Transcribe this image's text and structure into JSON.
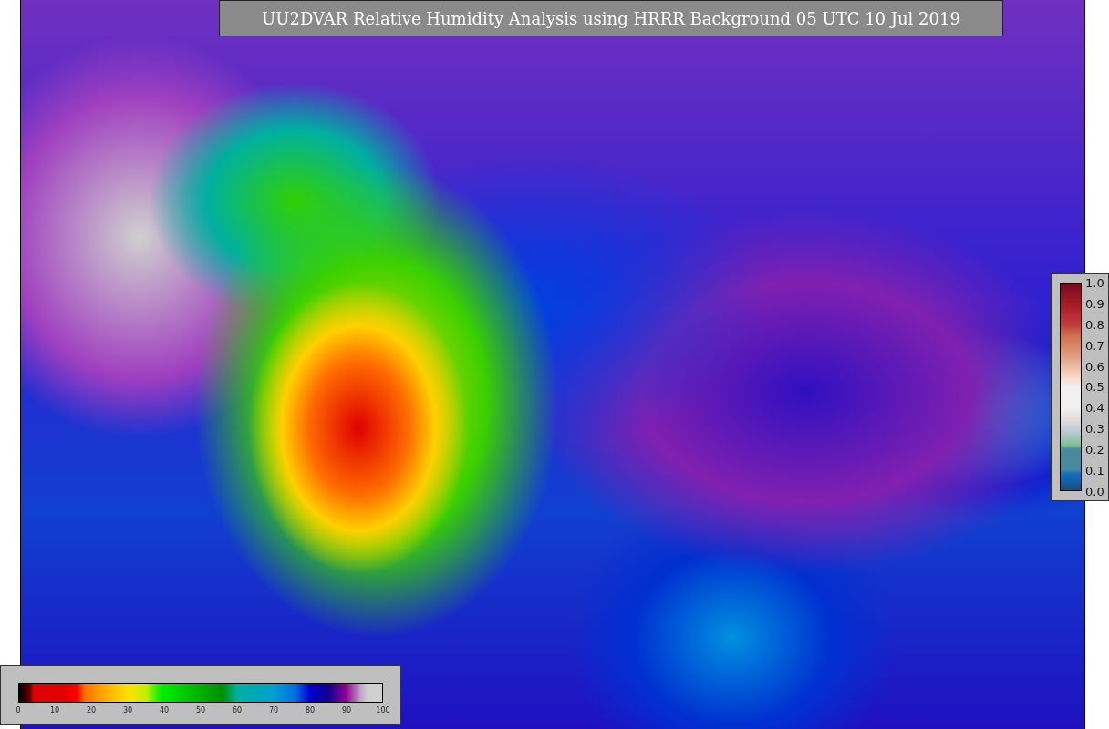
{
  "title": "UU2DVAR Relative Humidity Analysis using HRRR Background 05 UTC 10 Jul 2019",
  "humidity_colorbar": {
    "ticks": [
      "0",
      "10",
      "20",
      "30",
      "40",
      "50",
      "60",
      "70",
      "80",
      "90",
      "100"
    ]
  },
  "ratio_colorbar": {
    "ticks": [
      "1.0",
      "0.9",
      "0.8",
      "0.7",
      "0.6",
      "0.5",
      "0.4",
      "0.3",
      "0.2",
      "0.1",
      "0.0"
    ]
  }
}
